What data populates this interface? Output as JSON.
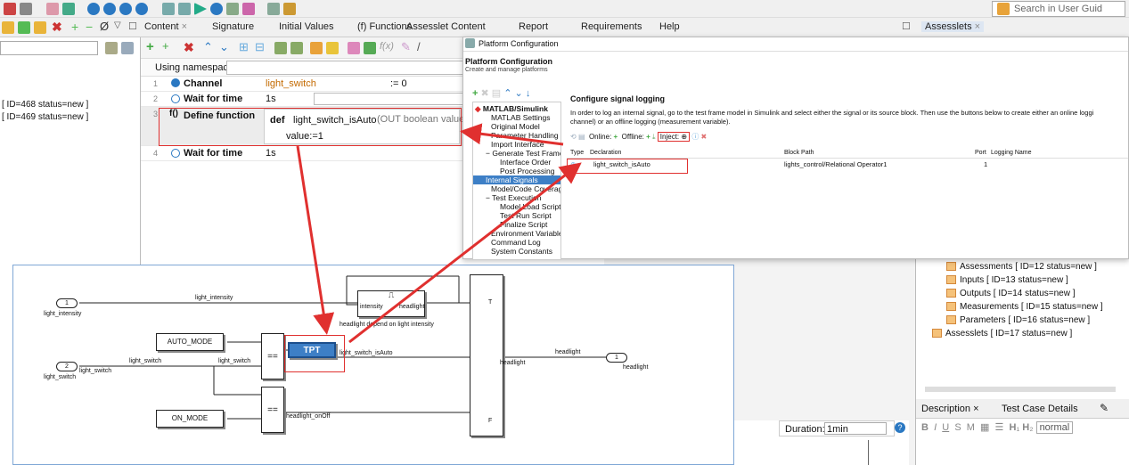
{
  "toolbar": {
    "search_placeholder": "Search in User Guid"
  },
  "tabs": [
    {
      "label": "Content"
    },
    {
      "label": "Signature"
    },
    {
      "label": "Initial Values"
    },
    {
      "label": "(f) Functions"
    },
    {
      "label": "Assesslet Content"
    },
    {
      "label": "Report"
    },
    {
      "label": "Requirements"
    },
    {
      "label": "Help"
    }
  ],
  "right_tab": {
    "label": "Assesslets"
  },
  "left_list": [
    "[ ID=468 status=new ]",
    "[ ID=469 status=new ]"
  ],
  "code": {
    "namespaces_label": "Using namespaces:",
    "rows": [
      {
        "num": "1",
        "kw": "Channel",
        "name": "light_switch",
        "value": ":= 0"
      },
      {
        "num": "2",
        "kw": "Wait for time",
        "value": "1s"
      },
      {
        "num": "3",
        "kw": "Define function",
        "def": "def",
        "func": "light_switch_isAuto",
        "sig": "(OUT boolean value)",
        "body": "value:=1"
      },
      {
        "num": "4",
        "kw": "Wait for time",
        "value": "1s"
      }
    ]
  },
  "platform": {
    "title": "Platform Configuration",
    "header": "Platform Configuration",
    "subheader": "Create and manage platforms",
    "section": "Configure signal logging",
    "desc": "In order to log an internal signal, go to the test frame model in Simulink and select either the signal or its source block. Then use the buttons below to create either an online loggi",
    "desc2": "channel) or an offline logging (measurement variable).",
    "online": "Online:",
    "offline": "Offline:",
    "inject": "Inject:",
    "cols": [
      "Type",
      "Declaration",
      "Block Path",
      "Port",
      "Logging Name"
    ],
    "row": {
      "decl": "light_switch_isAuto",
      "path": "lights_control/Relational Operator1",
      "port": "1"
    },
    "tree": [
      "MATLAB/Simulink",
      "MATLAB Settings",
      "Original Model",
      "Parameter Handling",
      "Import Interface",
      "Generate Test Frame",
      "Interface Order",
      "Post Processing",
      "Internal Signals",
      "Model/Code Coverage",
      "Test Execution",
      "Model Load Script",
      "Test Run Script",
      "Finalize Script",
      "Environment Variables",
      "Command Log",
      "System Constants"
    ]
  },
  "assesslets": [
    "Assessments  [ ID=12 status=new ]",
    "Inputs  [ ID=13 status=new ]",
    "Outputs  [ ID=14 status=new ]",
    "Measurements  [ ID=15 status=new ]",
    "Parameters  [ ID=16 status=new ]",
    "Assesslets  [ ID=17 status=new ]"
  ],
  "desc_panel": {
    "tab1": "Description",
    "tab2": "Test Case Details",
    "fmt": "normal"
  },
  "duration": {
    "label": "Duration:",
    "value": "1min"
  },
  "diagram": {
    "light_intensity": "light_intensity",
    "light_switch": "light_switch",
    "auto_mode": "AUTO_MODE",
    "on_mode": "ON_MODE",
    "intensity": "intensity",
    "headlight": "headlight",
    "headlight_depend": "headlight depend on light intensity",
    "switch_isAuto": "light_switch_isAuto",
    "onoff": "headlight_onOff",
    "tpt": "TPT",
    "port1": "1",
    "port2": "2",
    "out1": "1",
    "eq": "==",
    "T": "T",
    "F": "F"
  }
}
